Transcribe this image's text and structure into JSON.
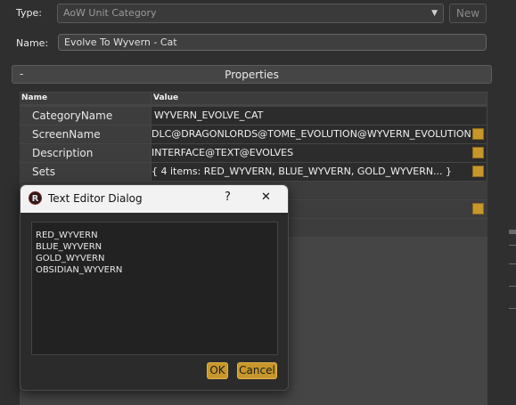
{
  "header": {
    "type_label": "Type:",
    "type_value": "AoW Unit Category",
    "new_label": "New",
    "name_label": "Name:",
    "name_value": "Evolve To Wyvern - Cat"
  },
  "properties": {
    "collapse_symbol": "-",
    "title": "Properties",
    "columns": [
      "Name",
      "Value"
    ],
    "rows": [
      {
        "name": "CategoryName",
        "value": "WYVERN_EVOLVE_CAT"
      },
      {
        "name": "ScreenName",
        "value": "DLC@DRAGONLORDS@TOME_EVOLUTION@WYVERN_EVOLUTION"
      },
      {
        "name": "Description",
        "value": "INTERFACE@TEXT@EVOLVES"
      },
      {
        "name": "Sets",
        "value": "{ 4 items: RED_WYVERN, BLUE_WYVERN, GOLD_WYVERN... }"
      }
    ]
  },
  "dialog": {
    "title": "Text Editor Dialog",
    "help": "?",
    "close": "✕",
    "logo_letter": "R",
    "lines": [
      "RED_WYVERN",
      "BLUE_WYVERN",
      "GOLD_WYVERN",
      "OBSIDIAN_WYVERN"
    ],
    "ok_label": "OK",
    "cancel_label": "Cancel"
  },
  "colors": {
    "accent": "#c8972b",
    "background": "#2f2f2f"
  }
}
